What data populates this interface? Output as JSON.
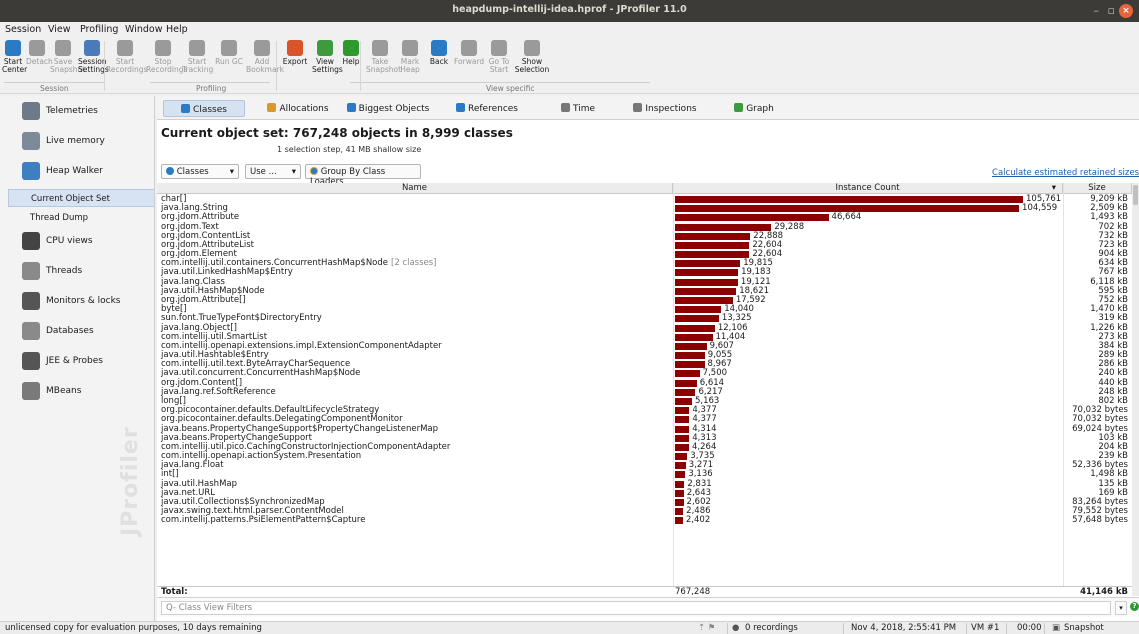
{
  "window": {
    "title": "heapdump-intellij-idea.hprof - JProfiler 11.0",
    "close_glyph": "×",
    "minimize_glyph": "–",
    "restore_glyph": "▫"
  },
  "menu": [
    "Session",
    "View",
    "Profiling",
    "Window",
    "Help"
  ],
  "toolbar": {
    "buttons": [
      {
        "label": "Start\nCenter",
        "icon": "start-center-icon",
        "color": "#2b7bc4",
        "enabled": true
      },
      {
        "label": "Detach",
        "icon": "detach-icon",
        "color": "#9a9a9a",
        "enabled": false
      },
      {
        "label": "Save\nSnapshot",
        "icon": "save-snapshot-icon",
        "color": "#9a9a9a",
        "enabled": false
      },
      {
        "label": "Session\nSettings",
        "icon": "session-settings-icon",
        "color": "#4a7bb8",
        "enabled": true
      },
      {
        "label": "Start\nRecordings",
        "icon": "start-recordings-icon",
        "color": "#9a9a9a",
        "enabled": false
      },
      {
        "label": "Stop\nRecordings",
        "icon": "stop-recordings-icon",
        "color": "#9a9a9a",
        "enabled": false
      },
      {
        "label": "Start\nTracking",
        "icon": "start-tracking-icon",
        "color": "#9a9a9a",
        "enabled": false
      },
      {
        "label": "Run GC",
        "icon": "run-gc-icon",
        "color": "#9a9a9a",
        "enabled": false
      },
      {
        "label": "Add\nBookmark",
        "icon": "add-bookmark-icon",
        "color": "#9a9a9a",
        "enabled": false
      },
      {
        "label": "Export",
        "icon": "export-icon",
        "color": "#d9542b",
        "enabled": true
      },
      {
        "label": "View\nSettings",
        "icon": "view-settings-icon",
        "color": "#3d9a3d",
        "enabled": true
      },
      {
        "label": "Help",
        "icon": "help-icon",
        "color": "#2e9a2e",
        "enabled": true
      },
      {
        "label": "Take\nSnapshot",
        "icon": "take-snapshot-icon",
        "color": "#9a9a9a",
        "enabled": false
      },
      {
        "label": "Mark\nHeap",
        "icon": "mark-heap-icon",
        "color": "#9a9a9a",
        "enabled": false
      },
      {
        "label": "Back",
        "icon": "back-icon",
        "color": "#2b7bc4",
        "enabled": true
      },
      {
        "label": "Forward",
        "icon": "forward-icon",
        "color": "#9a9a9a",
        "enabled": false
      },
      {
        "label": "Go To\nStart",
        "icon": "go-to-start-icon",
        "color": "#9a9a9a",
        "enabled": false
      },
      {
        "label": "Show\nSelection",
        "icon": "show-selection-icon",
        "color": "#9a9a9a",
        "enabled": true
      }
    ],
    "groups": [
      "Session",
      "Profiling",
      "View specific"
    ]
  },
  "sidebar": {
    "items": [
      {
        "label": "Telemetries",
        "icon": "telemetries-icon",
        "color": "#6c7a89"
      },
      {
        "label": "Live memory",
        "icon": "live-memory-icon",
        "color": "#7d8a97"
      },
      {
        "label": "Heap Walker",
        "icon": "heap-walker-icon",
        "color": "#3d7fc1"
      }
    ],
    "subitems": [
      {
        "label": "Current Object Set",
        "selected": true
      },
      {
        "label": "Thread Dump",
        "selected": false
      }
    ],
    "items2": [
      {
        "label": "CPU views",
        "icon": "cpu-views-icon",
        "color": "#444444"
      },
      {
        "label": "Threads",
        "icon": "threads-icon",
        "color": "#8a8a8a"
      },
      {
        "label": "Monitors & locks",
        "icon": "monitors-locks-icon",
        "color": "#555555"
      },
      {
        "label": "Databases",
        "icon": "databases-icon",
        "color": "#8a8a8a"
      },
      {
        "label": "JEE & Probes",
        "icon": "jee-probes-icon",
        "color": "#555555"
      },
      {
        "label": "MBeans",
        "icon": "mbeans-icon",
        "color": "#7a7a7a"
      }
    ],
    "watermark": "JProfiler"
  },
  "tabs": [
    {
      "label": "Classes",
      "icon": "classes-icon",
      "color": "#2b7bc4",
      "selected": true
    },
    {
      "label": "Allocations",
      "icon": "allocations-icon",
      "color": "#d99a2b",
      "selected": false
    },
    {
      "label": "Biggest Objects",
      "icon": "biggest-objects-icon",
      "color": "#2b7bc4",
      "selected": false
    },
    {
      "label": "References",
      "icon": "references-icon",
      "color": "#2b7bc4",
      "selected": false
    },
    {
      "label": "Time",
      "icon": "time-icon",
      "color": "#777777",
      "selected": false
    },
    {
      "label": "Inspections",
      "icon": "inspections-icon",
      "color": "#777777",
      "selected": false
    },
    {
      "label": "Graph",
      "icon": "graph-icon",
      "color": "#3d9a3d",
      "selected": false
    }
  ],
  "heading": "Current object set:  767,248 objects in 8,999 classes",
  "subheading": "1 selection step, 41 MB shallow size",
  "viewbar": {
    "view_combo": "Classes",
    "use_combo": "Use ...",
    "group_button": "Group By Class Loaders",
    "retained_link": "Calculate estimated retained sizes"
  },
  "table": {
    "columns": [
      "Name",
      "Instance Count",
      "Size"
    ],
    "max_count": 105761,
    "bar_color": "#8b0000",
    "rows": [
      {
        "name": "char[]",
        "extra": "",
        "count": 105761,
        "count_label": "105,761",
        "size": "9,209 kB"
      },
      {
        "name": "java.lang.String",
        "extra": "",
        "count": 104559,
        "count_label": "104,559",
        "size": "2,509 kB"
      },
      {
        "name": "org.jdom.Attribute",
        "extra": "",
        "count": 46664,
        "count_label": "46,664",
        "size": "1,493 kB"
      },
      {
        "name": "org.jdom.Text",
        "extra": "",
        "count": 29288,
        "count_label": "29,288",
        "size": "702 kB"
      },
      {
        "name": "org.jdom.ContentList",
        "extra": "",
        "count": 22888,
        "count_label": "22,888",
        "size": "732 kB"
      },
      {
        "name": "org.jdom.AttributeList",
        "extra": "",
        "count": 22604,
        "count_label": "22,604",
        "size": "723 kB"
      },
      {
        "name": "org.jdom.Element",
        "extra": "",
        "count": 22604,
        "count_label": "22,604",
        "size": "904 kB"
      },
      {
        "name": "com.intellij.util.containers.ConcurrentHashMap$Node",
        "extra": "[2 classes]",
        "count": 19815,
        "count_label": "19,815",
        "size": "634 kB"
      },
      {
        "name": "java.util.LinkedHashMap$Entry",
        "extra": "",
        "count": 19183,
        "count_label": "19,183",
        "size": "767 kB"
      },
      {
        "name": "java.lang.Class",
        "extra": "",
        "count": 19121,
        "count_label": "19,121",
        "size": "6,118 kB"
      },
      {
        "name": "java.util.HashMap$Node",
        "extra": "",
        "count": 18621,
        "count_label": "18,621",
        "size": "595 kB"
      },
      {
        "name": "org.jdom.Attribute[]",
        "extra": "",
        "count": 17592,
        "count_label": "17,592",
        "size": "752 kB"
      },
      {
        "name": "byte[]",
        "extra": "",
        "count": 14040,
        "count_label": "14,040",
        "size": "1,470 kB"
      },
      {
        "name": "sun.font.TrueTypeFont$DirectoryEntry",
        "extra": "",
        "count": 13325,
        "count_label": "13,325",
        "size": "319 kB"
      },
      {
        "name": "java.lang.Object[]",
        "extra": "",
        "count": 12106,
        "count_label": "12,106",
        "size": "1,226 kB"
      },
      {
        "name": "com.intellij.util.SmartList",
        "extra": "",
        "count": 11404,
        "count_label": "11,404",
        "size": "273 kB"
      },
      {
        "name": "com.intellij.openapi.extensions.impl.ExtensionComponentAdapter",
        "extra": "",
        "count": 9607,
        "count_label": "9,607",
        "size": "384 kB"
      },
      {
        "name": "java.util.Hashtable$Entry",
        "extra": "",
        "count": 9055,
        "count_label": "9,055",
        "size": "289 kB"
      },
      {
        "name": "com.intellij.util.text.ByteArrayCharSequence",
        "extra": "",
        "count": 8967,
        "count_label": "8,967",
        "size": "286 kB"
      },
      {
        "name": "java.util.concurrent.ConcurrentHashMap$Node",
        "extra": "",
        "count": 7500,
        "count_label": "7,500",
        "size": "240 kB"
      },
      {
        "name": "org.jdom.Content[]",
        "extra": "",
        "count": 6614,
        "count_label": "6,614",
        "size": "440 kB"
      },
      {
        "name": "java.lang.ref.SoftReference",
        "extra": "",
        "count": 6217,
        "count_label": "6,217",
        "size": "248 kB"
      },
      {
        "name": "long[]",
        "extra": "",
        "count": 5163,
        "count_label": "5,163",
        "size": "802 kB"
      },
      {
        "name": "org.picocontainer.defaults.DefaultLifecycleStrategy",
        "extra": "",
        "count": 4377,
        "count_label": "4,377",
        "size": "70,032 bytes"
      },
      {
        "name": "org.picocontainer.defaults.DelegatingComponentMonitor",
        "extra": "",
        "count": 4377,
        "count_label": "4,377",
        "size": "70,032 bytes"
      },
      {
        "name": "java.beans.PropertyChangeSupport$PropertyChangeListenerMap",
        "extra": "",
        "count": 4314,
        "count_label": "4,314",
        "size": "69,024 bytes"
      },
      {
        "name": "java.beans.PropertyChangeSupport",
        "extra": "",
        "count": 4313,
        "count_label": "4,313",
        "size": "103 kB"
      },
      {
        "name": "com.intellij.util.pico.CachingConstructorInjectionComponentAdapter",
        "extra": "",
        "count": 4264,
        "count_label": "4,264",
        "size": "204 kB"
      },
      {
        "name": "com.intellij.openapi.actionSystem.Presentation",
        "extra": "",
        "count": 3735,
        "count_label": "3,735",
        "size": "239 kB"
      },
      {
        "name": "java.lang.Float",
        "extra": "",
        "count": 3271,
        "count_label": "3,271",
        "size": "52,336 bytes"
      },
      {
        "name": "int[]",
        "extra": "",
        "count": 3136,
        "count_label": "3,136",
        "size": "1,498 kB"
      },
      {
        "name": "java.util.HashMap",
        "extra": "",
        "count": 2831,
        "count_label": "2,831",
        "size": "135 kB"
      },
      {
        "name": "java.net.URL",
        "extra": "",
        "count": 2643,
        "count_label": "2,643",
        "size": "169 kB"
      },
      {
        "name": "java.util.Collections$SynchronizedMap",
        "extra": "",
        "count": 2602,
        "count_label": "2,602",
        "size": "83,264 bytes"
      },
      {
        "name": "javax.swing.text.html.parser.ContentModel",
        "extra": "",
        "count": 2486,
        "count_label": "2,486",
        "size": "79,552 bytes"
      },
      {
        "name": "com.intellij.patterns.PsiElementPattern$Capture",
        "extra": "",
        "count": 2402,
        "count_label": "2,402",
        "size": "57,648 bytes"
      }
    ],
    "total": {
      "label": "Total:",
      "count": "767,248",
      "size": "41,146 kB"
    }
  },
  "filter": {
    "placeholder": "Q- Class View Filters"
  },
  "statusbar": {
    "license": "unlicensed copy for evaluation purposes, 10 days remaining",
    "recordings": "0 recordings",
    "datetime": "Nov 4, 2018, 2:55:41 PM",
    "vm": "VM #1",
    "time": "00:00",
    "mode": "Snapshot"
  }
}
